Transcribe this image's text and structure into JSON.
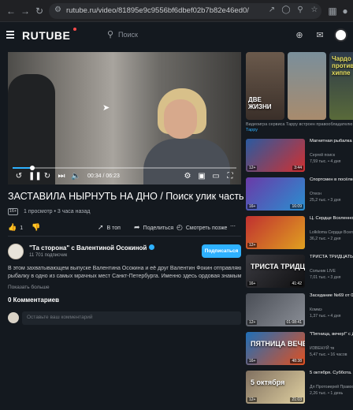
{
  "browser": {
    "back_icon": "arrow-left-icon",
    "forward_icon": "arrow-right-icon",
    "reload_icon": "reload-icon",
    "url": "rutube.ru/video/81895e9c9556bf6dbef02b7b82e46ed0/"
  },
  "site": {
    "logo": "RUTUBE",
    "search_placeholder": "Поиск"
  },
  "player": {
    "time": "00:34 / 06:23",
    "progress": 0.089
  },
  "video": {
    "title": "ЗАСТАВИЛА НЫРНУТЬ НА ДНО / Поиск улик часть 2-я",
    "age": "16+",
    "meta": "1 просмотр  •  3 часа назад",
    "likes": "1",
    "action_top": "В топ",
    "action_share": "Поделиться",
    "action_later": "Смотреть позже",
    "channel_name": "\"Та сторона\" с Валентиной Осокиной",
    "channel_subs": "11 701 подписчик",
    "subscribe": "Подписаться",
    "description_1": "В этом захватывающем выпуске Валентина Осокина и её друг Валентин Фокин отправляются на магнитную",
    "description_2": "рыбалку в одно из самых мрачных мест Санкт-Петербурга. Именно здесь ордовая знамым Банапарти, образ...",
    "show_more": "Показать больше",
    "comments_header": "0 Комментариев",
    "comment_placeholder": "Оставьте ваш комментарий"
  },
  "shorts": {
    "items": [
      {
        "text": "ДВЕ ЖИЗНИ"
      },
      {
        "text": ""
      },
      {
        "text": "Чардо против хиппе"
      }
    ],
    "caption_prefix": "Видеоигра сервиса Тарру встроен правообладателю ",
    "caption_link": "Тарру"
  },
  "recommendations": [
    {
      "age": "12+",
      "duration": "3:44",
      "thumb_text": "",
      "title": "Магнитная рыбалка у дома...",
      "channel": "Сергей поиск",
      "meta": "7,59 тыс. • 4 дня"
    },
    {
      "age": "16+",
      "duration": "16:09",
      "thumb_text": "",
      "title": "Спортсмен в посёлке...",
      "channel": "Отеон",
      "meta": "25,2 тыс. • 3 дня"
    },
    {
      "age": "12+",
      "duration": "",
      "thumb_text": "",
      "title": "Ц. Сердце Вселенной #24...",
      "channel": "Lolkiloma Сердце Вселенной",
      "meta": "36,2 тыс. • 2 дня"
    },
    {
      "age": "16+",
      "duration": "41:42",
      "thumb_text": "ТРИСТА ТРИДЦАТЬ ТРИ",
      "title": "ТРИСТА ТРИДЦАТЬ ТРИ! | ...",
      "channel": "Сольник LIVE",
      "meta": "7,01 тыс. • 3 дня"
    },
    {
      "age": "12+",
      "duration": "01:08:41",
      "thumb_text": "",
      "title": "Заседание №69 от 01.10.2024. Часть 2",
      "channel": "Коммэ",
      "meta": "1,37 тыс. • 4 дня"
    },
    {
      "age": "16+",
      "duration": "48:38",
      "thumb_text": "ПЯТНИЦА ВЕЧЕР!",
      "title": "\"Пятница, вечер!\" с Дмитрием...",
      "channel": "ИЗВЕНУЙ тв",
      "meta": "5,47 тыс. • 16 часов"
    },
    {
      "age": "12+",
      "duration": "21:03",
      "thumb_text": "5 октября",
      "title": "5 октября. Суббота. Евангелие дня 202...",
      "channel": "Дл Протоиерей Правосл...",
      "meta": "2,26 тыс. • 1 день"
    }
  ],
  "colors": {
    "accent": "#2eb1ff",
    "background": "#14191f",
    "logo_dot": "#ff4b4b"
  }
}
